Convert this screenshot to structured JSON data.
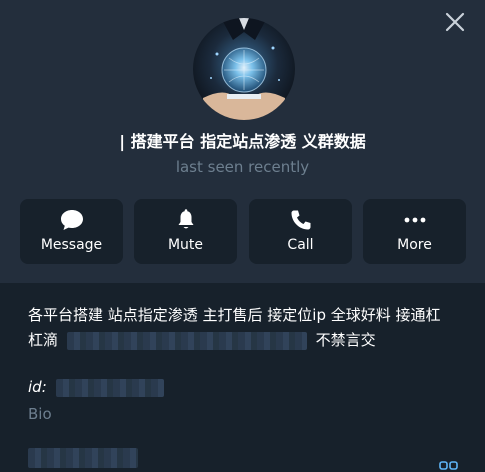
{
  "profile": {
    "name": "| 搭建平台 指定站点渗透 义群数据",
    "status": "last seen recently"
  },
  "actions": [
    {
      "label": "Message",
      "icon": "message-icon"
    },
    {
      "label": "Mute",
      "icon": "bell-icon"
    },
    {
      "label": "Call",
      "icon": "phone-icon"
    },
    {
      "label": "More",
      "icon": "more-icon"
    }
  ],
  "about": {
    "line1": "各平台搭建 站点指定渗透 主打售后 接定位ip 全球好料 接通杠",
    "line2_prefix": "杠滴",
    "line2_suffix": "不禁言交"
  },
  "details": {
    "id_label": "id:",
    "bio_label": "Bio"
  },
  "colors": {
    "background": "#17212b",
    "header": "#232e3c",
    "secondary_text": "#6d7f8f",
    "accent": "#5eb5f7"
  }
}
